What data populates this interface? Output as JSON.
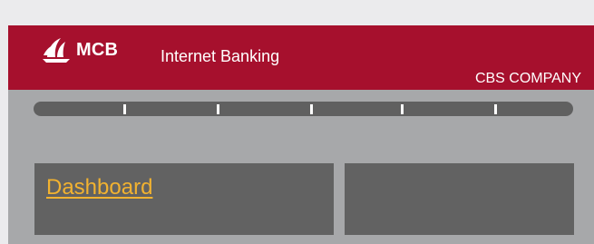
{
  "header": {
    "logo_text": "MCB",
    "app_title": "Internet Banking",
    "company": "CBS COMPANY"
  },
  "progress": {
    "steps": 6,
    "icon": "step-tick"
  },
  "panels": {
    "left": {
      "link_label": "Dashboard"
    }
  },
  "colors": {
    "brand": "#a6102d",
    "link": "#f2b230",
    "panel": "#626262",
    "frame": "#a7a8aa"
  }
}
